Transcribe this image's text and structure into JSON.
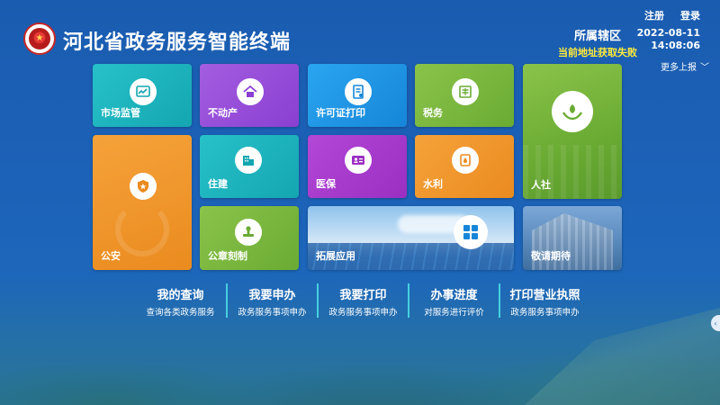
{
  "header": {
    "title": "河北省政务服务智能终端",
    "links": [
      "注册",
      "登录"
    ],
    "region_title": "所属辖区",
    "region_status": "当前地址获取失败",
    "date": "2022-08-11",
    "time": "14:08:06",
    "more_label": "更多上报"
  },
  "tiles": {
    "market": "市场监管",
    "estate": "不动产",
    "permit": "许可证打印",
    "tax": "税务",
    "social": "人社",
    "police": "公安",
    "build": "住建",
    "medic": "医保",
    "water": "水利",
    "seal": "公章刻制",
    "ext": "拓展应用",
    "wait": "敬请期待"
  },
  "links": [
    {
      "title": "我的查询",
      "sub": "查询各类政务服务"
    },
    {
      "title": "我要申办",
      "sub": "政务服务事项申办"
    },
    {
      "title": "我要打印",
      "sub": "政务服务事项申办"
    },
    {
      "title": "办事进度",
      "sub": "对服务进行评价"
    },
    {
      "title": "打印营业执照",
      "sub": "政务服务事项申办"
    }
  ],
  "colors": {
    "background": "#1c62b8",
    "teal": "#14a6b1",
    "purple": "#8a3fd1",
    "blue": "#1686d8",
    "green": "#6aab33",
    "orange": "#ea8b1f",
    "magenta": "#9a2fc2",
    "status_yellow": "#ffeb3b",
    "divider": "#45d0e0"
  },
  "icons": {
    "market": "chart-icon",
    "estate": "house-icon",
    "permit": "document-icon",
    "tax": "ledger-icon",
    "social": "hands-leaf-icon",
    "police": "badge-star-icon",
    "build": "building-icon",
    "medic": "id-card-icon",
    "water": "water-icon",
    "seal": "stamp-icon",
    "ext": "grid-icon"
  }
}
